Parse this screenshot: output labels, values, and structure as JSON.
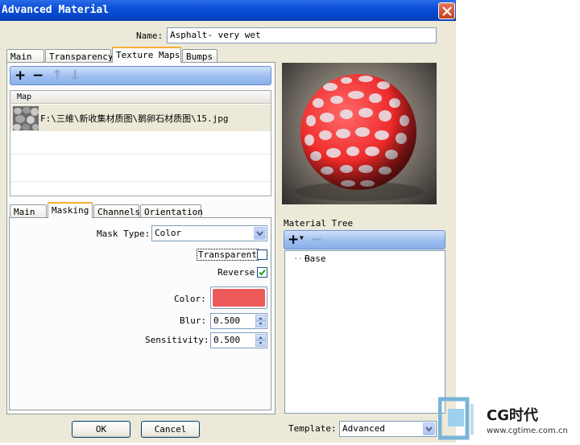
{
  "window": {
    "title": "Advanced Material"
  },
  "name_field": {
    "label": "Name:",
    "value": "Asphalt- very wet"
  },
  "top_tabs": [
    {
      "label": "Main",
      "active": false
    },
    {
      "label": "Transparency",
      "active": false
    },
    {
      "label": "Texture Maps",
      "active": true
    },
    {
      "label": "Bumps",
      "active": false
    }
  ],
  "map_list": {
    "header": "Map",
    "rows": [
      {
        "path": "F:\\三維\\新收集材质图\\鹅卵石材质图\\15.jpg"
      }
    ]
  },
  "sub_tabs": [
    {
      "label": "Main",
      "active": false
    },
    {
      "label": "Masking",
      "active": true
    },
    {
      "label": "Channels",
      "active": false
    },
    {
      "label": "Orientation",
      "active": false
    }
  ],
  "masking": {
    "mask_type_label": "Mask Type:",
    "mask_type_value": "Color",
    "transparent_label": "Transparent",
    "transparent_checked": false,
    "reverse_label": "Reverse",
    "reverse_checked": true,
    "color_label": "Color:",
    "color_value": "#ec5a5a",
    "blur_label": "Blur:",
    "blur_value": "0.500",
    "sensitivity_label": "Sensitivity:",
    "sensitivity_value": "0.500"
  },
  "material_tree": {
    "label": "Material Tree",
    "items": [
      "Base"
    ]
  },
  "template": {
    "label": "Template:",
    "value": "Advanced"
  },
  "buttons": {
    "ok": "OK",
    "cancel": "Cancel"
  },
  "watermark": {
    "text1": "CG时代",
    "text2": "www.cgtime.com.cn"
  }
}
